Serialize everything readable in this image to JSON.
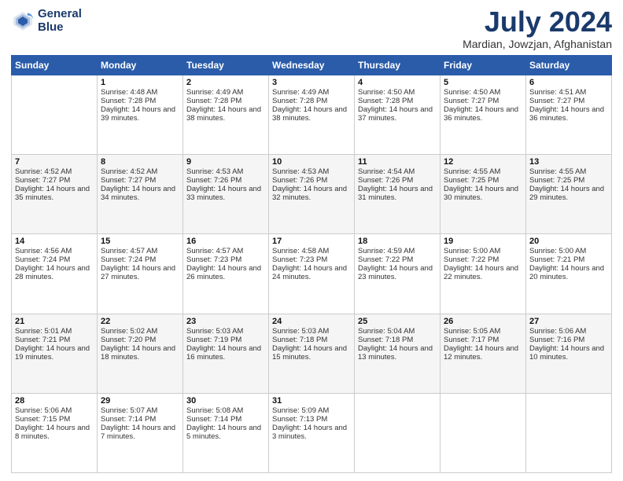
{
  "header": {
    "logo_line1": "General",
    "logo_line2": "Blue",
    "month_title": "July 2024",
    "location": "Mardian, Jowzjan, Afghanistan"
  },
  "days_of_week": [
    "Sunday",
    "Monday",
    "Tuesday",
    "Wednesday",
    "Thursday",
    "Friday",
    "Saturday"
  ],
  "weeks": [
    [
      {
        "day": "",
        "sunrise": "",
        "sunset": "",
        "daylight": ""
      },
      {
        "day": "1",
        "sunrise": "Sunrise: 4:48 AM",
        "sunset": "Sunset: 7:28 PM",
        "daylight": "Daylight: 14 hours and 39 minutes."
      },
      {
        "day": "2",
        "sunrise": "Sunrise: 4:49 AM",
        "sunset": "Sunset: 7:28 PM",
        "daylight": "Daylight: 14 hours and 38 minutes."
      },
      {
        "day": "3",
        "sunrise": "Sunrise: 4:49 AM",
        "sunset": "Sunset: 7:28 PM",
        "daylight": "Daylight: 14 hours and 38 minutes."
      },
      {
        "day": "4",
        "sunrise": "Sunrise: 4:50 AM",
        "sunset": "Sunset: 7:28 PM",
        "daylight": "Daylight: 14 hours and 37 minutes."
      },
      {
        "day": "5",
        "sunrise": "Sunrise: 4:50 AM",
        "sunset": "Sunset: 7:27 PM",
        "daylight": "Daylight: 14 hours and 36 minutes."
      },
      {
        "day": "6",
        "sunrise": "Sunrise: 4:51 AM",
        "sunset": "Sunset: 7:27 PM",
        "daylight": "Daylight: 14 hours and 36 minutes."
      }
    ],
    [
      {
        "day": "7",
        "sunrise": "Sunrise: 4:52 AM",
        "sunset": "Sunset: 7:27 PM",
        "daylight": "Daylight: 14 hours and 35 minutes."
      },
      {
        "day": "8",
        "sunrise": "Sunrise: 4:52 AM",
        "sunset": "Sunset: 7:27 PM",
        "daylight": "Daylight: 14 hours and 34 minutes."
      },
      {
        "day": "9",
        "sunrise": "Sunrise: 4:53 AM",
        "sunset": "Sunset: 7:26 PM",
        "daylight": "Daylight: 14 hours and 33 minutes."
      },
      {
        "day": "10",
        "sunrise": "Sunrise: 4:53 AM",
        "sunset": "Sunset: 7:26 PM",
        "daylight": "Daylight: 14 hours and 32 minutes."
      },
      {
        "day": "11",
        "sunrise": "Sunrise: 4:54 AM",
        "sunset": "Sunset: 7:26 PM",
        "daylight": "Daylight: 14 hours and 31 minutes."
      },
      {
        "day": "12",
        "sunrise": "Sunrise: 4:55 AM",
        "sunset": "Sunset: 7:25 PM",
        "daylight": "Daylight: 14 hours and 30 minutes."
      },
      {
        "day": "13",
        "sunrise": "Sunrise: 4:55 AM",
        "sunset": "Sunset: 7:25 PM",
        "daylight": "Daylight: 14 hours and 29 minutes."
      }
    ],
    [
      {
        "day": "14",
        "sunrise": "Sunrise: 4:56 AM",
        "sunset": "Sunset: 7:24 PM",
        "daylight": "Daylight: 14 hours and 28 minutes."
      },
      {
        "day": "15",
        "sunrise": "Sunrise: 4:57 AM",
        "sunset": "Sunset: 7:24 PM",
        "daylight": "Daylight: 14 hours and 27 minutes."
      },
      {
        "day": "16",
        "sunrise": "Sunrise: 4:57 AM",
        "sunset": "Sunset: 7:23 PM",
        "daylight": "Daylight: 14 hours and 26 minutes."
      },
      {
        "day": "17",
        "sunrise": "Sunrise: 4:58 AM",
        "sunset": "Sunset: 7:23 PM",
        "daylight": "Daylight: 14 hours and 24 minutes."
      },
      {
        "day": "18",
        "sunrise": "Sunrise: 4:59 AM",
        "sunset": "Sunset: 7:22 PM",
        "daylight": "Daylight: 14 hours and 23 minutes."
      },
      {
        "day": "19",
        "sunrise": "Sunrise: 5:00 AM",
        "sunset": "Sunset: 7:22 PM",
        "daylight": "Daylight: 14 hours and 22 minutes."
      },
      {
        "day": "20",
        "sunrise": "Sunrise: 5:00 AM",
        "sunset": "Sunset: 7:21 PM",
        "daylight": "Daylight: 14 hours and 20 minutes."
      }
    ],
    [
      {
        "day": "21",
        "sunrise": "Sunrise: 5:01 AM",
        "sunset": "Sunset: 7:21 PM",
        "daylight": "Daylight: 14 hours and 19 minutes."
      },
      {
        "day": "22",
        "sunrise": "Sunrise: 5:02 AM",
        "sunset": "Sunset: 7:20 PM",
        "daylight": "Daylight: 14 hours and 18 minutes."
      },
      {
        "day": "23",
        "sunrise": "Sunrise: 5:03 AM",
        "sunset": "Sunset: 7:19 PM",
        "daylight": "Daylight: 14 hours and 16 minutes."
      },
      {
        "day": "24",
        "sunrise": "Sunrise: 5:03 AM",
        "sunset": "Sunset: 7:18 PM",
        "daylight": "Daylight: 14 hours and 15 minutes."
      },
      {
        "day": "25",
        "sunrise": "Sunrise: 5:04 AM",
        "sunset": "Sunset: 7:18 PM",
        "daylight": "Daylight: 14 hours and 13 minutes."
      },
      {
        "day": "26",
        "sunrise": "Sunrise: 5:05 AM",
        "sunset": "Sunset: 7:17 PM",
        "daylight": "Daylight: 14 hours and 12 minutes."
      },
      {
        "day": "27",
        "sunrise": "Sunrise: 5:06 AM",
        "sunset": "Sunset: 7:16 PM",
        "daylight": "Daylight: 14 hours and 10 minutes."
      }
    ],
    [
      {
        "day": "28",
        "sunrise": "Sunrise: 5:06 AM",
        "sunset": "Sunset: 7:15 PM",
        "daylight": "Daylight: 14 hours and 8 minutes."
      },
      {
        "day": "29",
        "sunrise": "Sunrise: 5:07 AM",
        "sunset": "Sunset: 7:14 PM",
        "daylight": "Daylight: 14 hours and 7 minutes."
      },
      {
        "day": "30",
        "sunrise": "Sunrise: 5:08 AM",
        "sunset": "Sunset: 7:14 PM",
        "daylight": "Daylight: 14 hours and 5 minutes."
      },
      {
        "day": "31",
        "sunrise": "Sunrise: 5:09 AM",
        "sunset": "Sunset: 7:13 PM",
        "daylight": "Daylight: 14 hours and 3 minutes."
      },
      {
        "day": "",
        "sunrise": "",
        "sunset": "",
        "daylight": ""
      },
      {
        "day": "",
        "sunrise": "",
        "sunset": "",
        "daylight": ""
      },
      {
        "day": "",
        "sunrise": "",
        "sunset": "",
        "daylight": ""
      }
    ]
  ]
}
